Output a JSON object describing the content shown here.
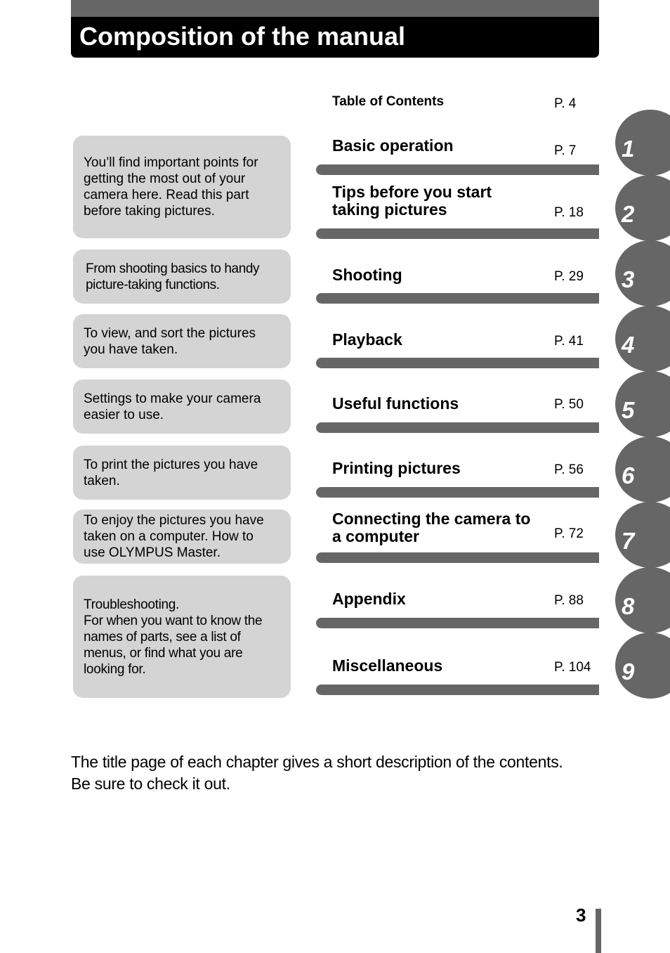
{
  "header": {
    "title": "Composition of the manual"
  },
  "toc": {
    "label": "Table of Contents",
    "page": "P. 4"
  },
  "descriptions": [
    "You’ll find important points for\ngetting the most out of your\ncamera here. Read this part\nbefore taking pictures.",
    "From shooting basics to handy\npicture-taking functions.",
    "To view, and sort the pictures\nyou have taken.",
    "Settings to make your camera\neasier to use.",
    "To print the pictures you have\ntaken.",
    "To enjoy the pictures you have\ntaken on a computer. How to\nuse OLYMPUS Master.",
    "Troubleshooting.\nFor when you want to know the\nnames of parts, see a list of\nmenus, or find what you are\nlooking for."
  ],
  "chapters": [
    {
      "label": "Basic operation",
      "page": "P. 7"
    },
    {
      "label": "Tips before you start\ntaking pictures",
      "page": "P. 18"
    },
    {
      "label": "Shooting",
      "page": "P. 29"
    },
    {
      "label": "Playback",
      "page": "P. 41"
    },
    {
      "label": "Useful functions",
      "page": "P. 50"
    },
    {
      "label": "Printing pictures",
      "page": "P. 56"
    },
    {
      "label": "Connecting the camera to\na computer",
      "page": "P. 72"
    },
    {
      "label": "Appendix",
      "page": "P. 88"
    },
    {
      "label": "Miscellaneous",
      "page": "P. 104"
    }
  ],
  "tabs": [
    "1",
    "2",
    "3",
    "4",
    "5",
    "6",
    "7",
    "8",
    "9"
  ],
  "footer": {
    "note": "The title page of each chapter gives a short description of the contents.\nBe sure to check it out.",
    "page_number": "3"
  },
  "colors": {
    "accent_gray": "#666666",
    "box_gray": "#d4d4d4",
    "title_black": "#000000"
  }
}
